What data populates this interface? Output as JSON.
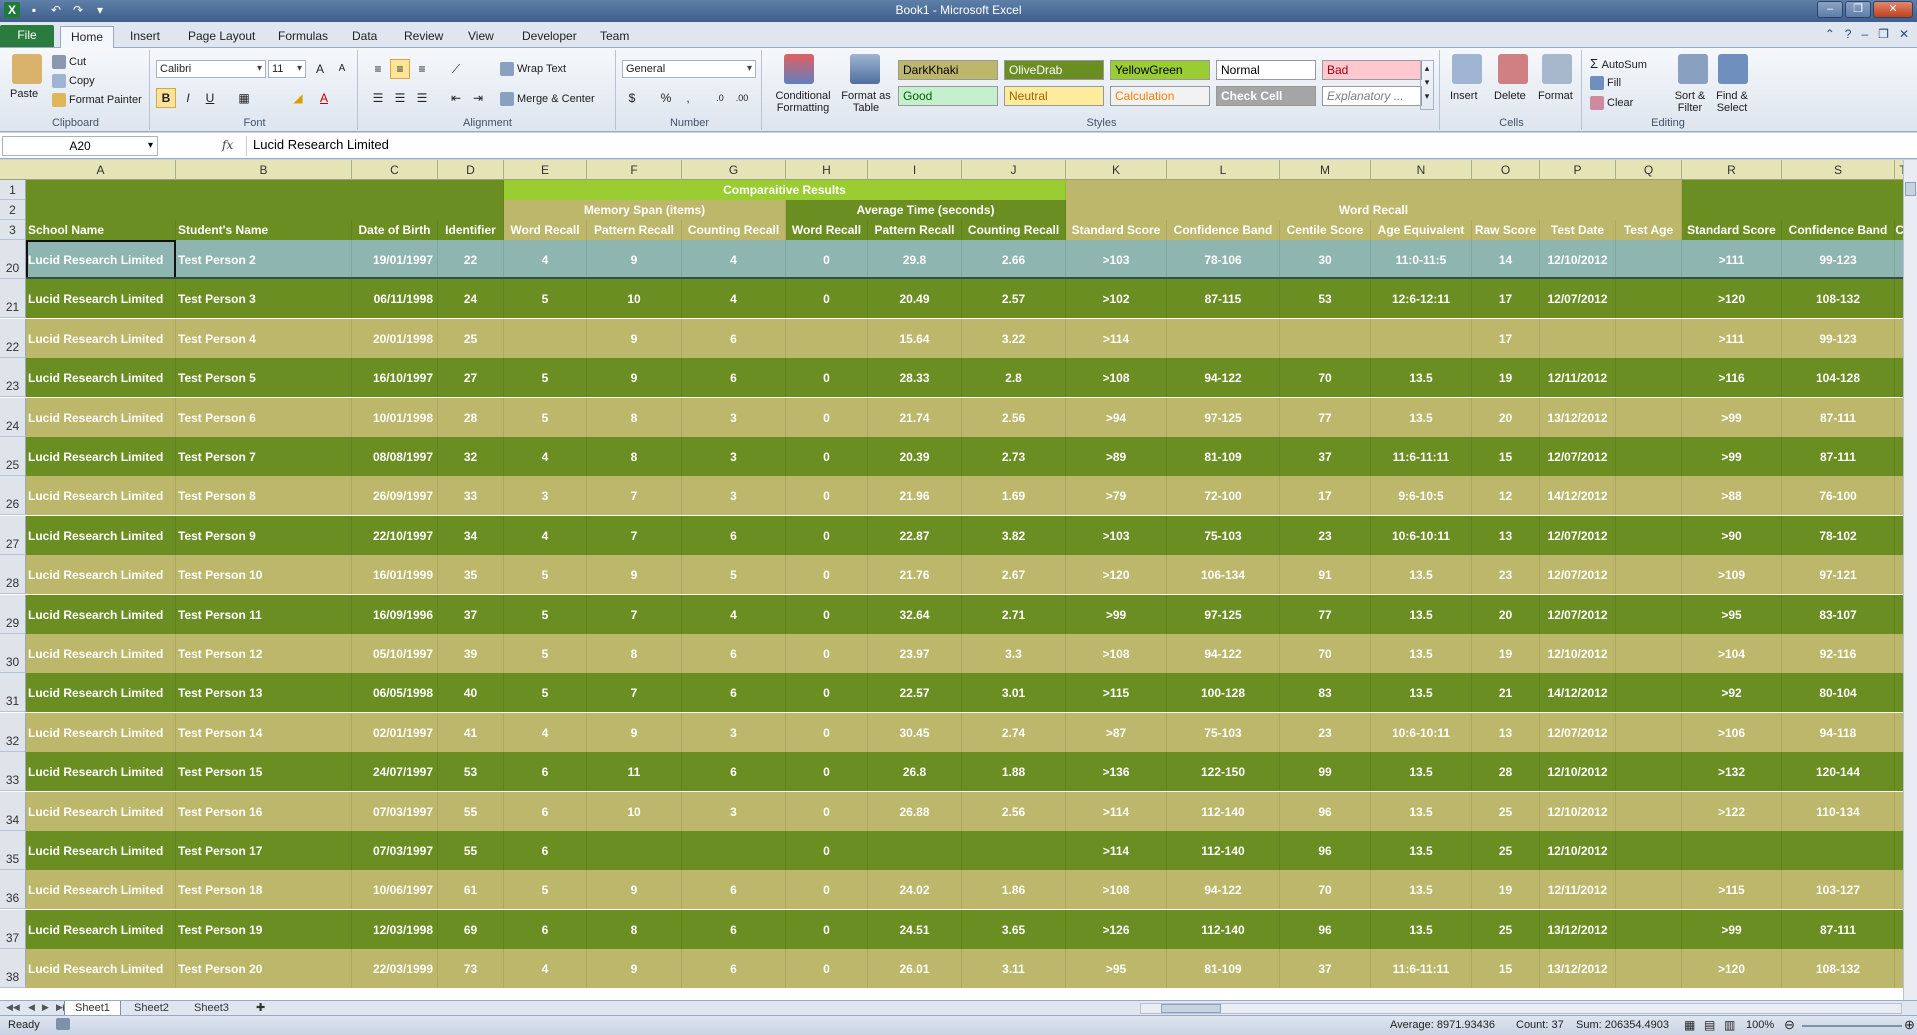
{
  "window": {
    "title": "Book1 - Microsoft Excel",
    "qat_icons": [
      "excel-icon",
      "save-icon",
      "undo-icon",
      "redo-icon",
      "customize-icon"
    ]
  },
  "ribbon_tabs": [
    "File",
    "Home",
    "Insert",
    "Page Layout",
    "Formulas",
    "Data",
    "Review",
    "View",
    "Developer",
    "Team"
  ],
  "active_tab": "Home",
  "ribbon": {
    "clipboard": {
      "label": "Clipboard",
      "paste": "Paste",
      "cut": "Cut",
      "copy": "Copy",
      "format_painter": "Format Painter"
    },
    "font": {
      "label": "Font",
      "font_name": "Calibri",
      "font_size": "11",
      "bold": "B",
      "italic": "I",
      "underline": "U"
    },
    "alignment": {
      "label": "Alignment",
      "wrap_text": "Wrap Text",
      "merge_center": "Merge & Center"
    },
    "number": {
      "label": "Number",
      "format": "General",
      "percent": "%",
      "comma": ","
    },
    "styles": {
      "label": "Styles",
      "conditional": "Conditional Formatting",
      "format_table": "Format as Table",
      "cells": [
        {
          "name": "DarkKhaki",
          "bg": "#bdb76b",
          "fg": "#000000"
        },
        {
          "name": "OliveDrab",
          "bg": "#6b8e23",
          "fg": "#ffffff"
        },
        {
          "name": "YellowGreen",
          "bg": "#9acd32",
          "fg": "#000000"
        },
        {
          "name": "Normal",
          "bg": "#ffffff",
          "fg": "#000000"
        },
        {
          "name": "Bad",
          "bg": "#ffc7ce",
          "fg": "#9c0006"
        },
        {
          "name": "Good",
          "bg": "#c6efce",
          "fg": "#006100"
        },
        {
          "name": "Neutral",
          "bg": "#ffeb9c",
          "fg": "#9c6500"
        },
        {
          "name": "Calculation",
          "bg": "#f2f2f2",
          "fg": "#fa7d00"
        },
        {
          "name": "Check Cell",
          "bg": "#a5a5a5",
          "fg": "#ffffff"
        },
        {
          "name": "Explanatory ...",
          "bg": "#ffffff",
          "fg": "#7f7f7f"
        }
      ]
    },
    "cells": {
      "label": "Cells",
      "insert": "Insert",
      "delete": "Delete",
      "format": "Format"
    },
    "editing": {
      "label": "Editing",
      "autosum": "AutoSum",
      "fill": "Fill",
      "clear": "Clear",
      "sort_filter": "Sort & Filter",
      "find_select": "Find & Select"
    }
  },
  "formula_bar": {
    "name_box": "A20",
    "fx": "fx",
    "value": "Lucid Research Limited"
  },
  "columns": [
    {
      "letter": "A",
      "w": 150
    },
    {
      "letter": "B",
      "w": 176
    },
    {
      "letter": "C",
      "w": 86
    },
    {
      "letter": "D",
      "w": 66
    },
    {
      "letter": "E",
      "w": 83
    },
    {
      "letter": "F",
      "w": 95
    },
    {
      "letter": "G",
      "w": 104
    },
    {
      "letter": "H",
      "w": 82
    },
    {
      "letter": "I",
      "w": 94
    },
    {
      "letter": "J",
      "w": 104
    },
    {
      "letter": "K",
      "w": 101
    },
    {
      "letter": "L",
      "w": 113
    },
    {
      "letter": "M",
      "w": 91
    },
    {
      "letter": "N",
      "w": 101
    },
    {
      "letter": "O",
      "w": 68
    },
    {
      "letter": "P",
      "w": 76
    },
    {
      "letter": "Q",
      "w": 66
    },
    {
      "letter": "R",
      "w": 100
    },
    {
      "letter": "S",
      "w": 113
    },
    {
      "letter": "T",
      "w": 17
    }
  ],
  "header_row1": {
    "title": "Comparaitive Results"
  },
  "header_row2": {
    "memory_span": "Memory Span (items)",
    "average_time": "Average Time (seconds)",
    "word_recall": "Word Recall"
  },
  "header_row3": [
    "School Name",
    "Student's Name",
    "Date of Birth",
    "Identifier",
    "Word Recall",
    "Pattern Recall",
    "Counting Recall",
    "Word Recall",
    "Pattern Recall",
    "Counting Recall",
    "Standard Score",
    "Confidence Band",
    "Centile Score",
    "Age Equivalent",
    "Raw Score",
    "Test Date",
    "Test Age",
    "Standard Score",
    "Confidence Band",
    "Ce"
  ],
  "row_numbers": [
    "1",
    "2",
    "3",
    "20",
    "21",
    "22",
    "23",
    "24",
    "25",
    "26",
    "27",
    "28",
    "29",
    "30",
    "31",
    "32",
    "33",
    "34",
    "35",
    "36",
    "37",
    "38"
  ],
  "rows": [
    [
      "Lucid Research Limited",
      "Test Person 2",
      "19/01/1997",
      "22",
      "4",
      "9",
      "4",
      "0",
      "29.8",
      "2.66",
      ">103",
      "78-106",
      "30",
      "11:0-11:5",
      "14",
      "12/10/2012",
      "",
      ">111",
      "99-123"
    ],
    [
      "Lucid Research Limited",
      "Test Person 3",
      "06/11/1998",
      "24",
      "5",
      "10",
      "4",
      "0",
      "20.49",
      "2.57",
      ">102",
      "87-115",
      "53",
      "12:6-12:11",
      "17",
      "12/07/2012",
      "",
      ">120",
      "108-132"
    ],
    [
      "Lucid Research Limited",
      "Test Person 4",
      "20/01/1998",
      "25",
      "",
      "9",
      "6",
      "",
      "15.64",
      "3.22",
      ">114",
      "",
      "",
      "",
      "17",
      "",
      "",
      ">111",
      "99-123"
    ],
    [
      "Lucid Research Limited",
      "Test Person 5",
      "16/10/1997",
      "27",
      "5",
      "9",
      "6",
      "0",
      "28.33",
      "2.8",
      ">108",
      "94-122",
      "70",
      "13.5",
      "19",
      "12/11/2012",
      "",
      ">116",
      "104-128"
    ],
    [
      "Lucid Research Limited",
      "Test Person 6",
      "10/01/1998",
      "28",
      "5",
      "8",
      "3",
      "0",
      "21.74",
      "2.56",
      ">94",
      "97-125",
      "77",
      "13.5",
      "20",
      "13/12/2012",
      "",
      ">99",
      "87-111"
    ],
    [
      "Lucid Research Limited",
      "Test Person 7",
      "08/08/1997",
      "32",
      "4",
      "8",
      "3",
      "0",
      "20.39",
      "2.73",
      ">89",
      "81-109",
      "37",
      "11:6-11:11",
      "15",
      "12/07/2012",
      "",
      ">99",
      "87-111"
    ],
    [
      "Lucid Research Limited",
      "Test Person 8",
      "26/09/1997",
      "33",
      "3",
      "7",
      "3",
      "0",
      "21.96",
      "1.69",
      ">79",
      "72-100",
      "17",
      "9:6-10:5",
      "12",
      "14/12/2012",
      "",
      ">88",
      "76-100"
    ],
    [
      "Lucid Research Limited",
      "Test Person 9",
      "22/10/1997",
      "34",
      "4",
      "7",
      "6",
      "0",
      "22.87",
      "3.82",
      ">103",
      "75-103",
      "23",
      "10:6-10:11",
      "13",
      "12/07/2012",
      "",
      ">90",
      "78-102"
    ],
    [
      "Lucid Research Limited",
      "Test Person 10",
      "16/01/1999",
      "35",
      "5",
      "9",
      "5",
      "0",
      "21.76",
      "2.67",
      ">120",
      "106-134",
      "91",
      "13.5",
      "23",
      "12/07/2012",
      "",
      ">109",
      "97-121"
    ],
    [
      "Lucid Research Limited",
      "Test Person 11",
      "16/09/1996",
      "37",
      "5",
      "7",
      "4",
      "0",
      "32.64",
      "2.71",
      ">99",
      "97-125",
      "77",
      "13.5",
      "20",
      "12/07/2012",
      "",
      ">95",
      "83-107"
    ],
    [
      "Lucid Research Limited",
      "Test Person 12",
      "05/10/1997",
      "39",
      "5",
      "8",
      "6",
      "0",
      "23.97",
      "3.3",
      ">108",
      "94-122",
      "70",
      "13.5",
      "19",
      "12/10/2012",
      "",
      ">104",
      "92-116"
    ],
    [
      "Lucid Research Limited",
      "Test Person 13",
      "06/05/1998",
      "40",
      "5",
      "7",
      "6",
      "0",
      "22.57",
      "3.01",
      ">115",
      "100-128",
      "83",
      "13.5",
      "21",
      "14/12/2012",
      "",
      ">92",
      "80-104"
    ],
    [
      "Lucid Research Limited",
      "Test Person 14",
      "02/01/1997",
      "41",
      "4",
      "9",
      "3",
      "0",
      "30.45",
      "2.74",
      ">87",
      "75-103",
      "23",
      "10:6-10:11",
      "13",
      "12/07/2012",
      "",
      ">106",
      "94-118"
    ],
    [
      "Lucid Research Limited",
      "Test Person 15",
      "24/07/1997",
      "53",
      "6",
      "11",
      "6",
      "0",
      "26.8",
      "1.88",
      ">136",
      "122-150",
      "99",
      "13.5",
      "28",
      "12/10/2012",
      "",
      ">132",
      "120-144"
    ],
    [
      "Lucid Research Limited",
      "Test Person 16",
      "07/03/1997",
      "55",
      "6",
      "10",
      "3",
      "0",
      "26.88",
      "2.56",
      ">114",
      "112-140",
      "96",
      "13.5",
      "25",
      "12/10/2012",
      "",
      ">122",
      "110-134"
    ],
    [
      "Lucid Research Limited",
      "Test Person 17",
      "07/03/1997",
      "55",
      "6",
      "",
      "",
      "0",
      "",
      "",
      ">114",
      "112-140",
      "96",
      "13.5",
      "25",
      "12/10/2012",
      "",
      "",
      ""
    ],
    [
      "Lucid Research Limited",
      "Test Person 18",
      "10/06/1997",
      "61",
      "5",
      "9",
      "6",
      "0",
      "24.02",
      "1.86",
      ">108",
      "94-122",
      "70",
      "13.5",
      "19",
      "12/11/2012",
      "",
      ">115",
      "103-127"
    ],
    [
      "Lucid Research Limited",
      "Test Person 19",
      "12/03/1998",
      "69",
      "6",
      "8",
      "6",
      "0",
      "24.51",
      "3.65",
      ">126",
      "112-140",
      "96",
      "13.5",
      "25",
      "13/12/2012",
      "",
      ">99",
      "87-111"
    ],
    [
      "Lucid Research Limited",
      "Test Person 20",
      "22/03/1999",
      "73",
      "4",
      "9",
      "6",
      "0",
      "26.01",
      "3.11",
      ">95",
      "81-109",
      "37",
      "11:6-11:11",
      "15",
      "13/12/2012",
      "",
      ">120",
      "108-132"
    ]
  ],
  "colors": {
    "olive_drab": "#6b8e23",
    "dark_khaki": "#bdb76b",
    "yellow_green": "#9acd32",
    "selected_row": "#8fb5b0",
    "khaki_header": "#bdb76b"
  },
  "sheet_tabs": [
    "Sheet1",
    "Sheet2",
    "Sheet3"
  ],
  "status": {
    "ready": "Ready",
    "average": "Average: 8971.93436",
    "count": "Count: 37",
    "sum": "Sum: 206354.4903",
    "zoom": "100%"
  }
}
